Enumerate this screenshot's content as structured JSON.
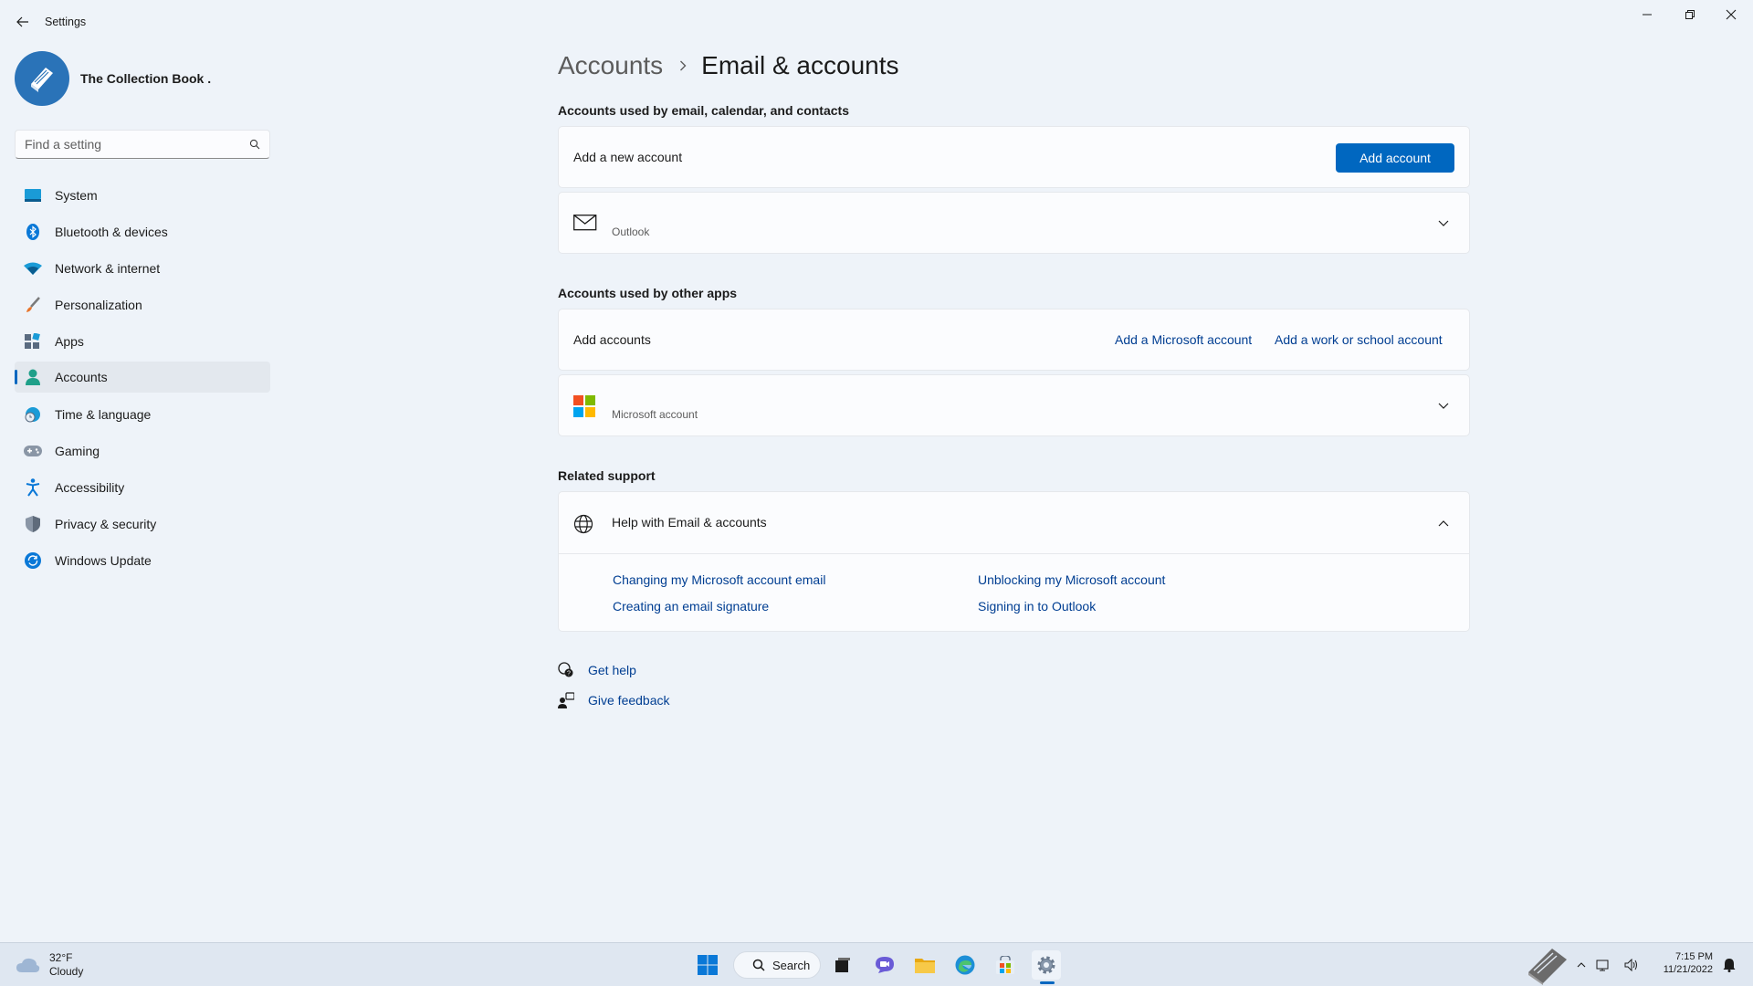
{
  "window": {
    "title": "Settings",
    "controls": [
      "minimize",
      "restore",
      "close"
    ]
  },
  "profile": {
    "name": "The Collection Book ."
  },
  "search": {
    "placeholder": "Find a setting"
  },
  "sidebar": {
    "items": [
      {
        "label": "System",
        "icon": "system-icon"
      },
      {
        "label": "Bluetooth & devices",
        "icon": "bluetooth-icon"
      },
      {
        "label": "Network & internet",
        "icon": "wifi-icon"
      },
      {
        "label": "Personalization",
        "icon": "brush-icon"
      },
      {
        "label": "Apps",
        "icon": "apps-icon"
      },
      {
        "label": "Accounts",
        "icon": "person-icon",
        "active": true
      },
      {
        "label": "Time & language",
        "icon": "clock-globe-icon"
      },
      {
        "label": "Gaming",
        "icon": "gamepad-icon"
      },
      {
        "label": "Accessibility",
        "icon": "accessibility-icon"
      },
      {
        "label": "Privacy & security",
        "icon": "shield-icon"
      },
      {
        "label": "Windows Update",
        "icon": "update-icon"
      }
    ]
  },
  "breadcrumb": {
    "parent": "Accounts",
    "current": "Email & accounts"
  },
  "email_section": {
    "title": "Accounts used by email, calendar, and contacts",
    "add_row_label": "Add a new account",
    "add_button": "Add account",
    "account": {
      "provider": "Outlook",
      "icon": "mail-icon"
    }
  },
  "apps_section": {
    "title": "Accounts used by other apps",
    "add_row_label": "Add accounts",
    "link_microsoft": "Add a Microsoft account",
    "link_work": "Add a work or school account",
    "account": {
      "provider": "Microsoft account",
      "icon": "microsoft-logo-icon"
    }
  },
  "support_section": {
    "title": "Related support",
    "help_title": "Help with Email & accounts",
    "links": [
      "Changing my Microsoft account email",
      "Unblocking my Microsoft account",
      "Creating an email signature",
      "Signing in to Outlook"
    ]
  },
  "footer_links": {
    "get_help": "Get help",
    "give_feedback": "Give feedback"
  },
  "taskbar": {
    "weather_temp": "32°F",
    "weather_desc": "Cloudy",
    "search_label": "Search",
    "time": "7:15 PM",
    "date": "11/21/2022"
  },
  "colors": {
    "accent": "#0067c0",
    "background": "#eef3f9",
    "card": "#fbfcfe",
    "link": "#003e92"
  }
}
